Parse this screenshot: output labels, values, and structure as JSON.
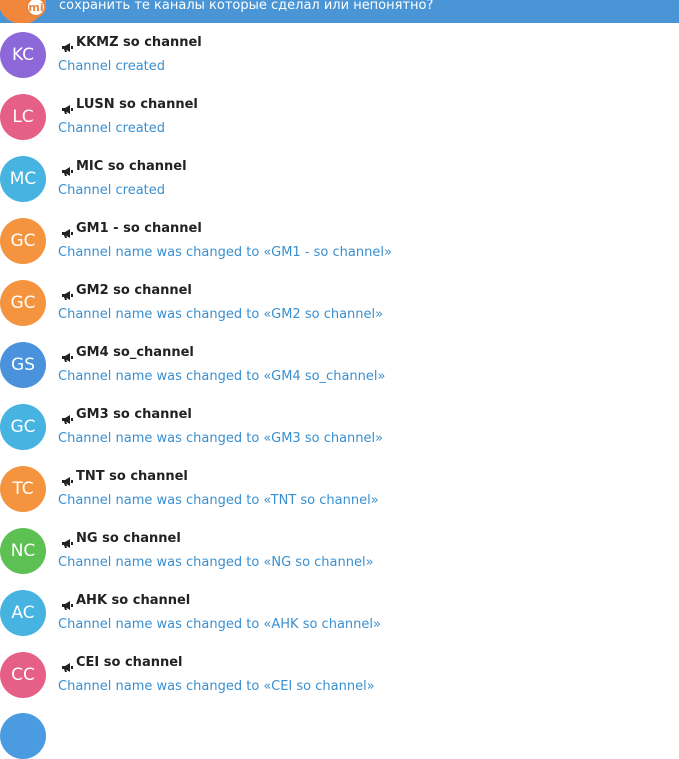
{
  "top_message": {
    "badge": "mi",
    "text": "сохранить те каналы которые сделал или непонятно?"
  },
  "icons": {
    "channel": "megaphone-icon"
  },
  "avatar_colors": {
    "purple": "#8d68d8",
    "pink": "#e55f86",
    "cyan": "#47b3e0",
    "orange": "#f5943e",
    "blue": "#4a92db",
    "green": "#5cc052"
  },
  "channels": [
    {
      "initials": "KC",
      "name": "KKMZ so channel",
      "event": "Channel created",
      "color": "#8d68d8"
    },
    {
      "initials": "LC",
      "name": "LUSN so channel",
      "event": "Channel created",
      "color": "#e55f86"
    },
    {
      "initials": "MC",
      "name": "MIC so channel",
      "event": "Channel created",
      "color": "#47b3e0"
    },
    {
      "initials": "GC",
      "name": "GM1 - so channel",
      "event": "Channel name was changed to «GM1 - so channel»",
      "color": "#f5943e"
    },
    {
      "initials": "GC",
      "name": "GM2 so channel",
      "event": "Channel name was changed to «GM2 so channel»",
      "color": "#f5943e"
    },
    {
      "initials": "GS",
      "name": "GM4 so_channel",
      "event": "Channel name was changed to «GM4 so_channel»",
      "color": "#4a92db"
    },
    {
      "initials": "GC",
      "name": "GM3 so channel",
      "event": "Channel name was changed to «GM3 so channel»",
      "color": "#47b3e0"
    },
    {
      "initials": "TC",
      "name": "TNT so channel",
      "event": "Channel name was changed to «TNT so channel»",
      "color": "#f5943e"
    },
    {
      "initials": "NC",
      "name": "NG so channel",
      "event": "Channel name was changed to «NG so channel»",
      "color": "#5cc052"
    },
    {
      "initials": "AC",
      "name": "AHK so channel",
      "event": "Channel name was changed to «AHK so channel»",
      "color": "#47b3e0"
    },
    {
      "initials": "CC",
      "name": "CEI so channel",
      "event": "Channel name was changed to «CEI so channel»",
      "color": "#e55f86"
    }
  ]
}
